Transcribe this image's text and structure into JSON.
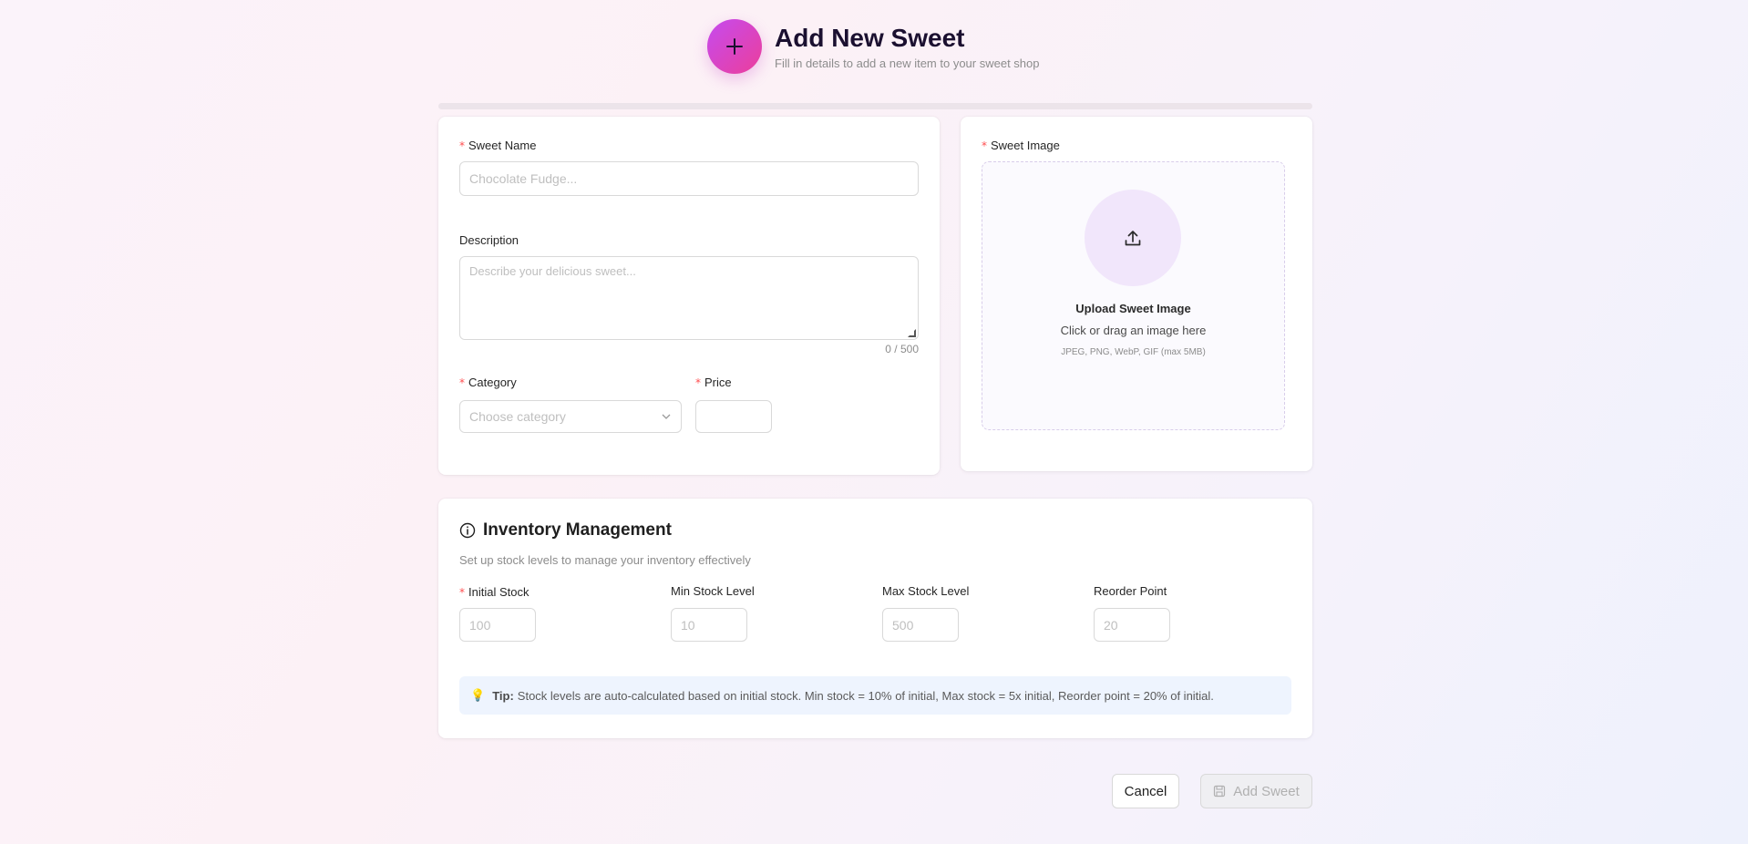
{
  "header": {
    "icon": "plus-icon",
    "title": "Add New Sweet",
    "subtitle": "Fill in details to add a new item to your sweet shop"
  },
  "form": {
    "name": {
      "label": "Sweet Name",
      "required": true,
      "placeholder": "Chocolate Fudge...",
      "value": ""
    },
    "description": {
      "label": "Description",
      "placeholder": "Describe your delicious sweet...",
      "value": "",
      "counter": "0 / 500"
    },
    "category": {
      "label": "Category",
      "required": true,
      "placeholder": "Choose category",
      "icon": "chevron-down-icon"
    },
    "price": {
      "label": "Price",
      "required": true,
      "value": ""
    }
  },
  "image_upload": {
    "label": "Sweet Image",
    "required": true,
    "icon": "upload-icon",
    "title": "Upload Sweet Image",
    "subtitle": "Click or drag an image here",
    "hint": "JPEG, PNG, WebP, GIF (max 5MB)"
  },
  "inventory": {
    "icon": "info-icon",
    "title": "Inventory Management",
    "description": "Set up stock levels to manage your inventory effectively",
    "fields": [
      {
        "label": "Initial Stock",
        "required": true,
        "placeholder": "100"
      },
      {
        "label": "Min Stock Level",
        "required": false,
        "placeholder": "10"
      },
      {
        "label": "Max Stock Level",
        "required": false,
        "placeholder": "500"
      },
      {
        "label": "Reorder Point",
        "required": false,
        "placeholder": "20"
      }
    ],
    "tip": {
      "icon": "lightbulb-icon",
      "label": "Tip:",
      "text": "Stock levels are auto-calculated based on initial stock. Min stock = 10% of initial, Max stock = 5x initial, Reorder point = 20% of initial."
    }
  },
  "actions": {
    "cancel_label": "Cancel",
    "submit_label": "Add Sweet",
    "submit_icon": "save-icon",
    "submit_disabled": true
  },
  "colors": {
    "accent_start": "#c54bf0",
    "accent_end": "#ec3e9a",
    "required": "#ff4d4f",
    "tip_bg": "#eef4fe"
  }
}
